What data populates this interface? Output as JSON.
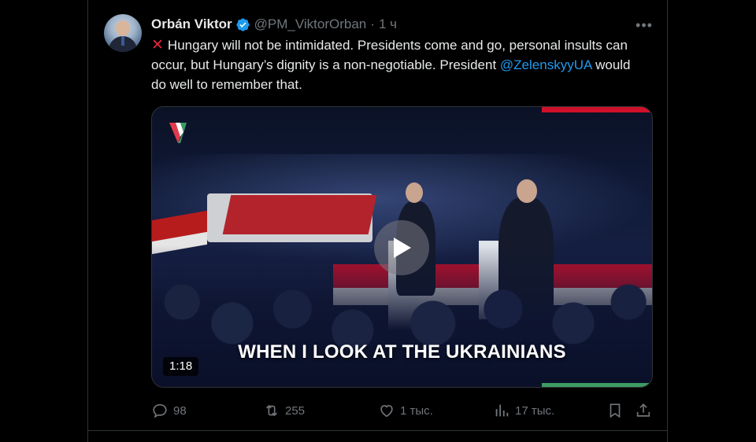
{
  "author": {
    "name": "Orbán Viktor",
    "handle": "@PM_ViktorOrban",
    "separator": "·",
    "time": "1 ч"
  },
  "tweet": {
    "icon": "cross-mark-emoji",
    "text_part1": "Hungary will not be intimidated. Presidents come and go, personal insults can occur, but Hungary’s dignity is a non-negotiable. President ",
    "mention": "@ZelenskyyUA",
    "text_part2": " would do well to remember that."
  },
  "media": {
    "caption": "WHEN I LOOK AT THE UKRAINIANS",
    "duration": "1:18",
    "colors": {
      "red": "#d0112b",
      "green": "#3c9b63"
    }
  },
  "actions": {
    "replies": "98",
    "reposts": "255",
    "likes": "1 тыс.",
    "views": "17 тыс."
  },
  "colors": {
    "background": "#000000",
    "text": "#e7e9ea",
    "muted": "#71767b",
    "link": "#1d9bf0",
    "verified": "#1d9bf0"
  }
}
